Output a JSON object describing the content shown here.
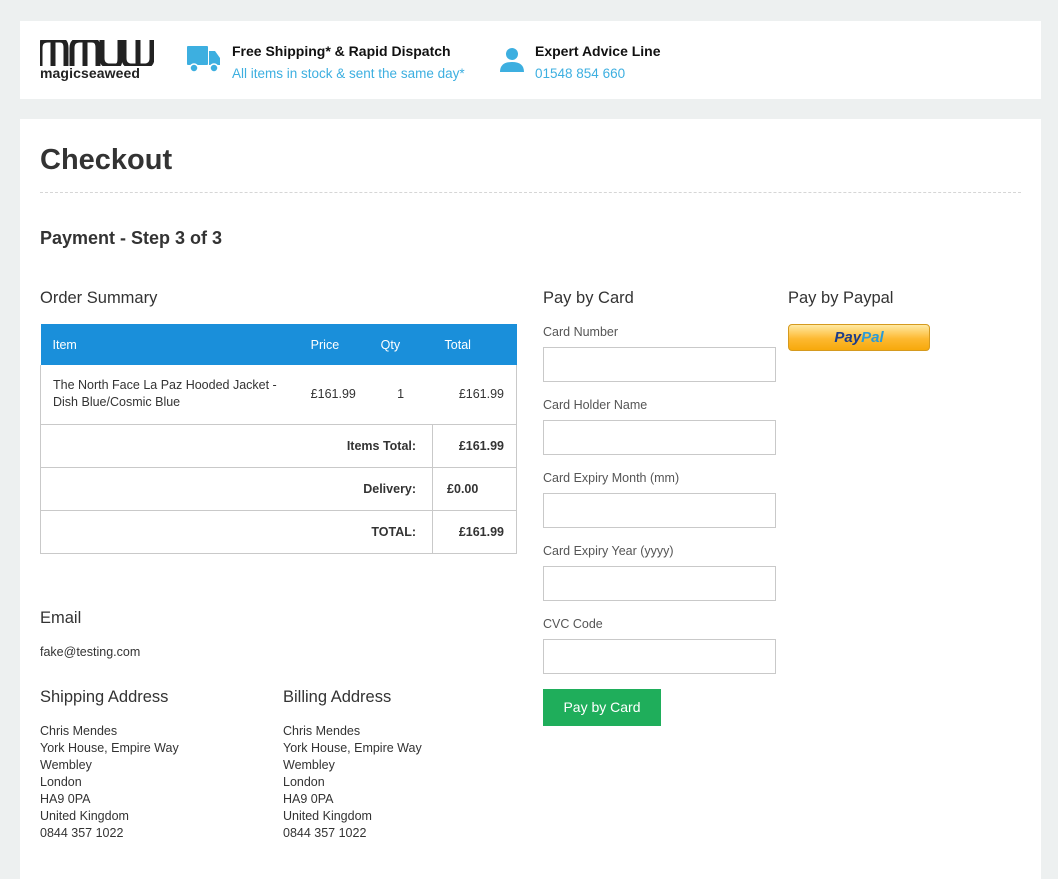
{
  "header": {
    "logo_text": "magicseaweed",
    "shipping": {
      "title": "Free Shipping* & Rapid Dispatch",
      "subtitle": "All items in stock & sent the same day*",
      "icon": "truck-icon"
    },
    "advice": {
      "title": "Expert Advice Line",
      "phone": "01548 854 660",
      "icon": "person-icon"
    },
    "accent_color": "#3dafe0"
  },
  "page": {
    "title": "Checkout",
    "step": "Payment - Step 3 of 3"
  },
  "order_summary": {
    "heading": "Order Summary",
    "columns": {
      "item": "Item",
      "price": "Price",
      "qty": "Qty",
      "total": "Total"
    },
    "items": [
      {
        "name": "The North Face La Paz Hooded Jacket - Dish Blue/Cosmic Blue",
        "price": "£161.99",
        "qty": "1",
        "total": "£161.99"
      }
    ],
    "items_total_label": "Items Total:",
    "items_total": "£161.99",
    "delivery_label": "Delivery:",
    "delivery": "£0.00",
    "grand_total_label": "TOTAL:",
    "grand_total": "£161.99",
    "header_color": "#1a8fda"
  },
  "email": {
    "heading": "Email",
    "value": "fake@testing.com"
  },
  "shipping_address": {
    "heading": "Shipping Address",
    "lines": [
      "Chris Mendes",
      "York House, Empire Way",
      "Wembley",
      "London",
      "HA9 0PA",
      "United Kingdom",
      "0844 357 1022"
    ]
  },
  "billing_address": {
    "heading": "Billing Address",
    "lines": [
      "Chris Mendes",
      "York House, Empire Way",
      "Wembley",
      "London",
      "HA9 0PA",
      "United Kingdom",
      "0844 357 1022"
    ]
  },
  "card": {
    "heading": "Pay by Card",
    "fields": [
      {
        "label": "Card Number",
        "value": ""
      },
      {
        "label": "Card Holder Name",
        "value": ""
      },
      {
        "label": "Card Expiry Month (mm)",
        "value": ""
      },
      {
        "label": "Card Expiry Year (yyyy)",
        "value": ""
      },
      {
        "label": "CVC Code",
        "value": ""
      }
    ],
    "button_label": "Pay by Card",
    "button_color": "#1fae5b"
  },
  "paypal": {
    "heading": "Pay by Paypal",
    "button_text_a": "Pay",
    "button_text_b": "Pal"
  }
}
